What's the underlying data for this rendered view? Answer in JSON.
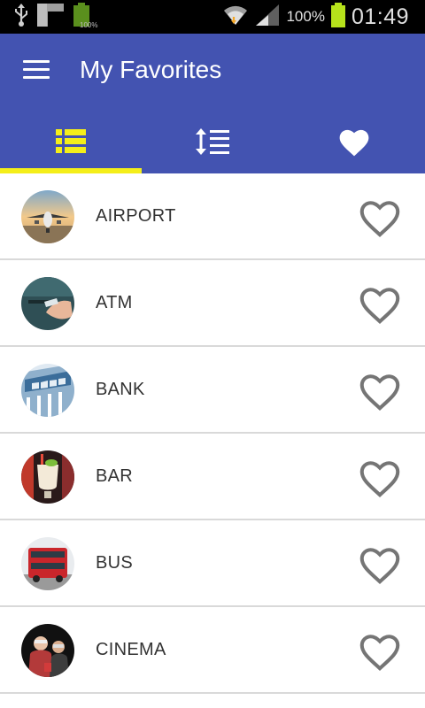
{
  "status_bar": {
    "notification_battery_label": "100%",
    "battery_percent": "100%",
    "time": "01:49"
  },
  "app_bar": {
    "title": "My Favorites",
    "menu_icon": "hamburger-menu-icon"
  },
  "tabs": [
    {
      "icon": "list-view-icon",
      "selected": true
    },
    {
      "icon": "sort-icon",
      "selected": false
    },
    {
      "icon": "heart-filled-icon",
      "selected": false
    }
  ],
  "colors": {
    "primary": "#4353b1",
    "tab_indicator": "#f4ee1a",
    "selected_tab_icon": "#f4ee1a",
    "tab_icon": "#ffffff",
    "heart_outline": "#757575"
  },
  "favorites": [
    {
      "label": "AIRPORT",
      "icon": "airplane-photo"
    },
    {
      "label": "ATM",
      "icon": "atm-card-photo"
    },
    {
      "label": "BANK",
      "icon": "bank-building-photo"
    },
    {
      "label": "BAR",
      "icon": "cocktail-photo"
    },
    {
      "label": "BUS",
      "icon": "double-decker-bus-photo"
    },
    {
      "label": "CINEMA",
      "icon": "cinema-audience-photo"
    }
  ]
}
